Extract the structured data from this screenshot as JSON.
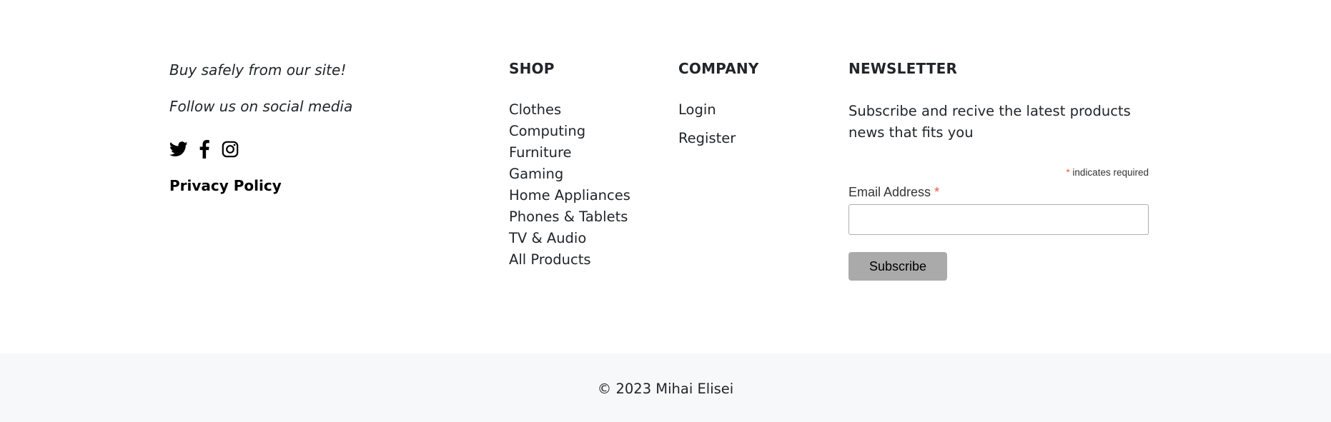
{
  "about": {
    "tagline_1": "Buy safely from our site!",
    "tagline_2": "Follow us on social media",
    "social": [
      {
        "icon": "twitter-icon",
        "label": "Twitter"
      },
      {
        "icon": "facebook-icon",
        "label": "Facebook"
      },
      {
        "icon": "instagram-icon",
        "label": "Instagram"
      }
    ],
    "privacy_label": "Privacy Policy"
  },
  "shop": {
    "title": "SHOP",
    "items": [
      {
        "label": "Clothes"
      },
      {
        "label": "Computing"
      },
      {
        "label": "Furniture"
      },
      {
        "label": "Gaming"
      },
      {
        "label": "Home Appliances"
      },
      {
        "label": "Phones & Tablets"
      },
      {
        "label": "TV & Audio"
      },
      {
        "label": "All Products"
      }
    ]
  },
  "company": {
    "title": "COMPANY",
    "items": [
      {
        "label": "Login"
      },
      {
        "label": "Register"
      }
    ]
  },
  "newsletter": {
    "title": "NEWSLETTER",
    "description": "Subscribe and recive the latest products news that fits you",
    "required_asterisk": "*",
    "required_note": " indicates required",
    "email_label": "Email Address ",
    "email_asterisk": "*",
    "email_value": "",
    "subscribe_label": "Subscribe"
  },
  "footer": {
    "copyright": "© 2023 Mihai Elisei"
  },
  "colors": {
    "text": "#212529",
    "required": "#e85c41",
    "button_bg": "#aaaaaa",
    "bar_bg": "#f7f8f9"
  }
}
